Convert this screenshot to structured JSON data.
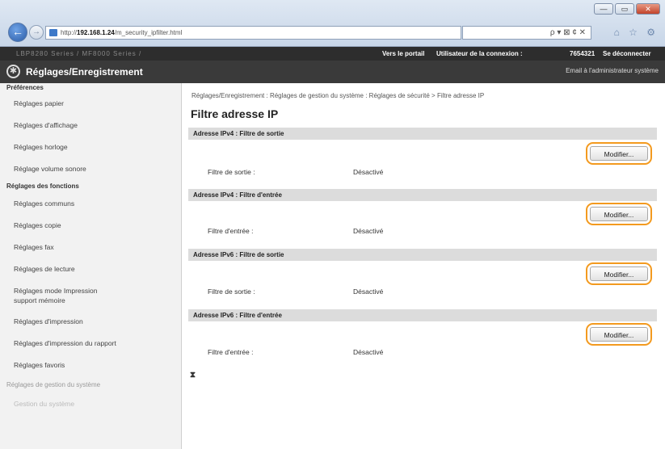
{
  "browser": {
    "url_prefix": "http://",
    "url_host": "192.168.1.24",
    "url_path": "/m_security_ipfilter.html",
    "toolbar_icons": "ρ ▾ ⊠ ¢ ✕",
    "fav_icons": "⌂ ☆ ⚙",
    "win_min": "—",
    "win_max": "▭",
    "win_close": "✕"
  },
  "topbar": {
    "device": "LBP8280 Series / MF8000 Series /",
    "portal": "Vers le portail",
    "user_label": "Utilisateur de la connexion :",
    "user_id": "7654321",
    "logout": "Se déconnecter"
  },
  "header": {
    "logo_icon": "gear-icon",
    "title": "Réglages/Enregistrement",
    "mail": "Email à l'administrateur système"
  },
  "sidebar": {
    "preferences_heading": "Préférences",
    "preferences": [
      "Réglages papier",
      "Réglages d'affichage",
      "Réglages horloge",
      "Réglage volume sonore"
    ],
    "functions_heading": "Réglages des fonctions",
    "functions": [
      "Réglages communs",
      "Réglages copie",
      "Réglages fax",
      "Réglages de lecture",
      "Réglages mode Impression support mémoire",
      "Réglages d'impression",
      "Réglages d'impression du rapport",
      "Réglages favoris"
    ],
    "management_heading": "Réglages de gestion du système",
    "management_item": "Gestion du système"
  },
  "main": {
    "breadcrumb": "Réglages/Enregistrement : Réglages de gestion du système : Réglages de sécurité > Filtre adresse IP",
    "title": "Filtre adresse IP",
    "sections": [
      {
        "heading": "Adresse IPv4 : Filtre de sortie",
        "label": "Filtre de sortie :",
        "value": "Désactivé",
        "button": "Modifier..."
      },
      {
        "heading": "Adresse IPv4 : Filtre d'entrée",
        "label": "Filtre d'entrée :",
        "value": "Désactivé",
        "button": "Modifier..."
      },
      {
        "heading": "Adresse IPv6 : Filtre de sortie",
        "label": "Filtre de sortie :",
        "value": "Désactivé",
        "button": "Modifier..."
      },
      {
        "heading": "Adresse IPv6 : Filtre d'entrée",
        "label": "Filtre d'entrée :",
        "value": "Désactivé",
        "button": "Modifier..."
      }
    ],
    "to_top": "⧗"
  },
  "colors": {
    "highlight": "#f39a1f",
    "section_bg": "#dcdcdc",
    "header_bg": "#3a3a3a"
  }
}
